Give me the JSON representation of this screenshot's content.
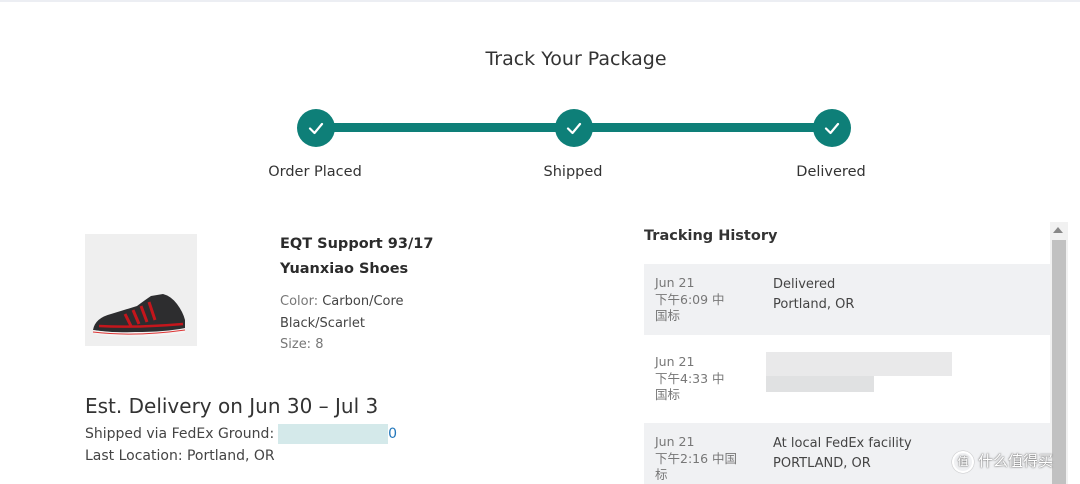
{
  "page": {
    "title": "Track Your Package"
  },
  "progress": {
    "color": "#0e7f78",
    "steps": [
      {
        "label": "Order Placed",
        "done": true
      },
      {
        "label": "Shipped",
        "done": true
      },
      {
        "label": "Delivered",
        "done": true
      }
    ]
  },
  "product": {
    "name_line1": "EQT Support 93/17",
    "name_line2": "Yuanxiao Shoes",
    "color_label": "Color:",
    "color_value_1": "Carbon/Core",
    "color_value_2": "Black/Scarlet",
    "size_label": "Size:",
    "size_value": "8"
  },
  "delivery": {
    "estimate": "Est. Delivery on Jun 30 – Jul 3",
    "shipped_via": "Shipped via FedEx Ground:",
    "tracking_tail": "0",
    "last_location": "Last Location: Portland, OR"
  },
  "history": {
    "title": "Tracking History",
    "events": [
      {
        "date": "Jun 21",
        "time": "下午6:09 中",
        "tz": "国标",
        "status": "Delivered",
        "location": "Portland, OR"
      },
      {
        "date": "Jun 21",
        "time": "下午4:33 中",
        "tz": "国标",
        "status": "",
        "location": ""
      },
      {
        "date": "Jun 21",
        "time": "下午2:16 中国",
        "tz": "标",
        "status": "At local FedEx facility",
        "location": "PORTLAND, OR"
      }
    ]
  },
  "watermark": {
    "text": "什么值得买",
    "icon": "值"
  }
}
